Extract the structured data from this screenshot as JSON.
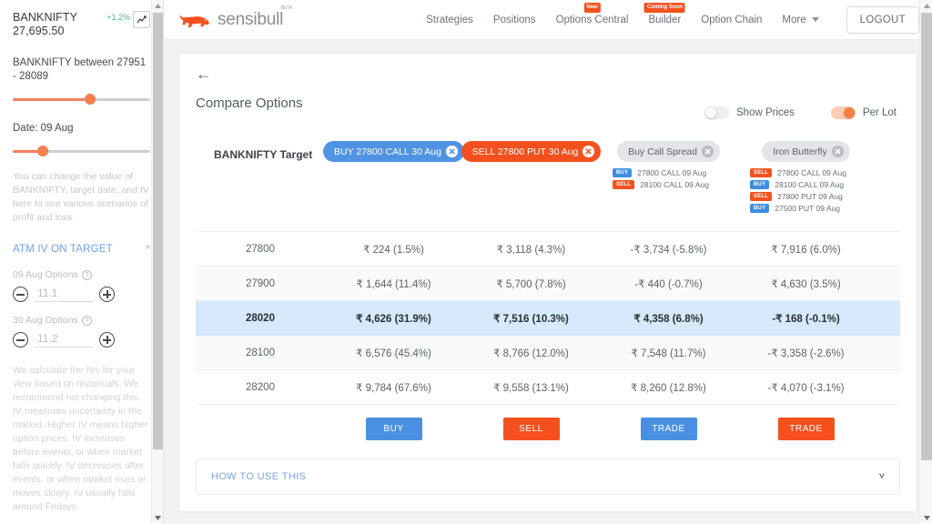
{
  "sidebar": {
    "symbol_name": "BANKNIFTY",
    "symbol_price": "27,695.50",
    "change_pct": "+1.2%",
    "range_label": "BANKNIFTY between 27951 - 28089",
    "date_label": "Date: 09 Aug",
    "note": "You can change the value of BANKNIFTY, target date, and IV here to see various scenarios of profit and loss.",
    "section_title": "ATM IV ON TARGET",
    "iv_groups": [
      {
        "label": "09 Aug Options",
        "value": "11.1"
      },
      {
        "label": "30 Aug Options",
        "value": "11.2"
      }
    ],
    "footer_note": "We calculate the IVs for your view based on historicals. We recommend not changing this. IV measures uncertainty in the market. Higher IV means higher option prices. IV increases before events, or when market falls quickly. IV decreases after events, or when market rises or moves slowly. IV usually falls around Fridays."
  },
  "topbar": {
    "brand": "sensibull",
    "brand_superscript": "BETA",
    "nav": [
      {
        "label": "Strategies",
        "badge": ""
      },
      {
        "label": "Positions",
        "badge": ""
      },
      {
        "label": "Options Central",
        "badge": "New"
      },
      {
        "label": "Builder",
        "badge": "Coming Soon"
      },
      {
        "label": "Option Chain",
        "badge": ""
      }
    ],
    "more_label": "More",
    "logout_label": "LOGOUT"
  },
  "page": {
    "title": "Compare Options",
    "target_label": "BANKNIFTY Target",
    "toggles": [
      {
        "label": "Show Prices",
        "state": "off"
      },
      {
        "label": "Per Lot",
        "state": "on"
      }
    ],
    "columns": [
      {
        "pill_label": "BUY 27800 CALL 30 Aug",
        "pill_style": "buy",
        "legs": [],
        "action_label": "BUY",
        "action_style": "blue"
      },
      {
        "pill_label": "SELL 27800 PUT 30 Aug",
        "pill_style": "sell",
        "legs": [],
        "action_label": "SELL",
        "action_style": "org"
      },
      {
        "pill_label": "Buy Call Spread",
        "pill_style": "grey",
        "legs": [
          {
            "side": "BUY",
            "side_style": "b",
            "text": "27800 CALL 09 Aug"
          },
          {
            "side": "SELL",
            "side_style": "s",
            "text": "28100 CALL 09 Aug"
          }
        ],
        "action_label": "TRADE",
        "action_style": "blue"
      },
      {
        "pill_label": "Iron Butterfly",
        "pill_style": "grey",
        "legs": [
          {
            "side": "SELL",
            "side_style": "s",
            "text": "27800 CALL 09 Aug"
          },
          {
            "side": "BUY",
            "side_style": "b",
            "text": "28100 CALL 09 Aug"
          },
          {
            "side": "SELL",
            "side_style": "s",
            "text": "27800 PUT 09 Aug"
          },
          {
            "side": "BUY",
            "side_style": "b",
            "text": "27500 PUT 09 Aug"
          }
        ],
        "action_label": "TRADE",
        "action_style": "org"
      }
    ],
    "rows": [
      {
        "strike": "27800",
        "highlight": false,
        "alt": false,
        "values": [
          "₹ 224 (1.5%)",
          "₹ 3,118 (4.3%)",
          "-₹ 3,734 (-5.8%)",
          "₹ 7,916 (6.0%)"
        ]
      },
      {
        "strike": "27900",
        "highlight": false,
        "alt": true,
        "values": [
          "₹ 1,644 (11.4%)",
          "₹ 5,700 (7.8%)",
          "-₹ 440 (-0.7%)",
          "₹ 4,630 (3.5%)"
        ]
      },
      {
        "strike": "28020",
        "highlight": true,
        "alt": false,
        "values": [
          "₹ 4,626 (31.9%)",
          "₹ 7,516 (10.3%)",
          "₹ 4,358 (6.8%)",
          "-₹ 168 (-0.1%)"
        ]
      },
      {
        "strike": "28100",
        "highlight": false,
        "alt": true,
        "values": [
          "₹ 6,576 (45.4%)",
          "₹ 8,766 (12.0%)",
          "₹ 7,548 (11.7%)",
          "-₹ 3,358 (-2.6%)"
        ]
      },
      {
        "strike": "28200",
        "highlight": false,
        "alt": false,
        "values": [
          "₹ 9,784 (67.6%)",
          "₹ 9,558 (13.1%)",
          "₹ 8,260 (12.8%)",
          "-₹ 4,070 (-3.1%)"
        ]
      }
    ],
    "howto_label": "HOW TO USE THIS"
  },
  "colors": {
    "brand_orange": "#f4511e",
    "buy_blue": "#4a90e2",
    "highlight_row": "#d6eafb",
    "accent_slider": "#f4804f",
    "link_blue": "#7ba6e8"
  }
}
